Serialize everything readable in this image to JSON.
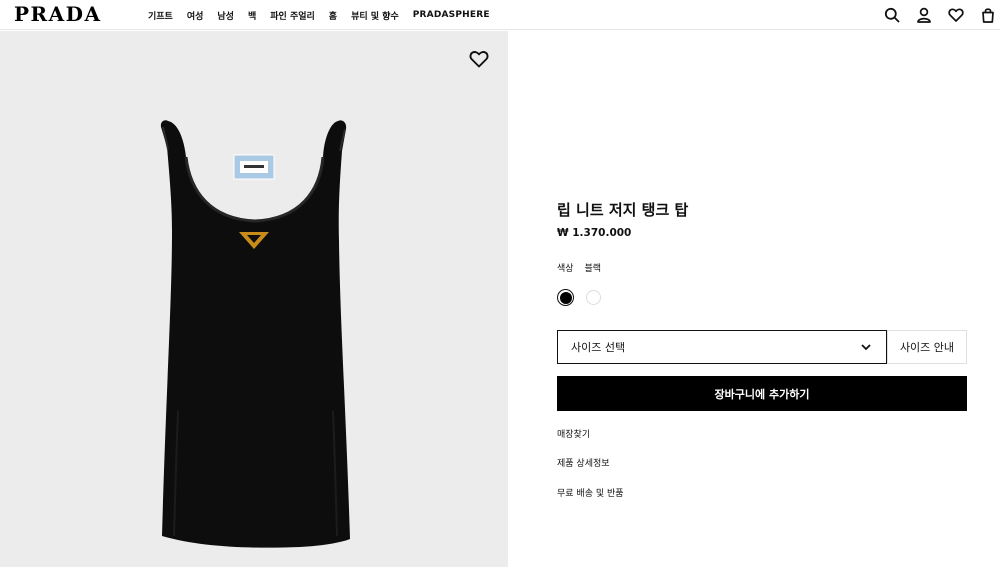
{
  "header": {
    "logo": "PRADA",
    "nav": [
      "기프트",
      "여성",
      "남성",
      "백",
      "파인 주얼리",
      "홈",
      "뷰티 및 향수",
      "PRADASPHERE"
    ],
    "icons": [
      "search-icon",
      "account-icon",
      "wishlist-icon",
      "shopping-bag-icon"
    ]
  },
  "product": {
    "name": "립 니트 저지 탱크 탑",
    "price": "₩ 1.370.000",
    "color_label": "색상",
    "color_value": "블랙",
    "swatches": [
      {
        "name": "black",
        "color": "#000000",
        "selected": true
      },
      {
        "name": "white",
        "color": "#ffffff",
        "selected": false
      }
    ],
    "image_colors": {
      "background": "#ececec",
      "garment": "#0d0d0d",
      "label": "#a9c9e4",
      "logo": "#c98b1a"
    }
  },
  "actions": {
    "size_select": "사이즈 선택",
    "size_guide": "사이즈 안내",
    "add_to_cart": "장바구니에 추가하기"
  },
  "links": [
    "매장찾기",
    "제품 상세정보",
    "무료 배송 및 반품"
  ]
}
